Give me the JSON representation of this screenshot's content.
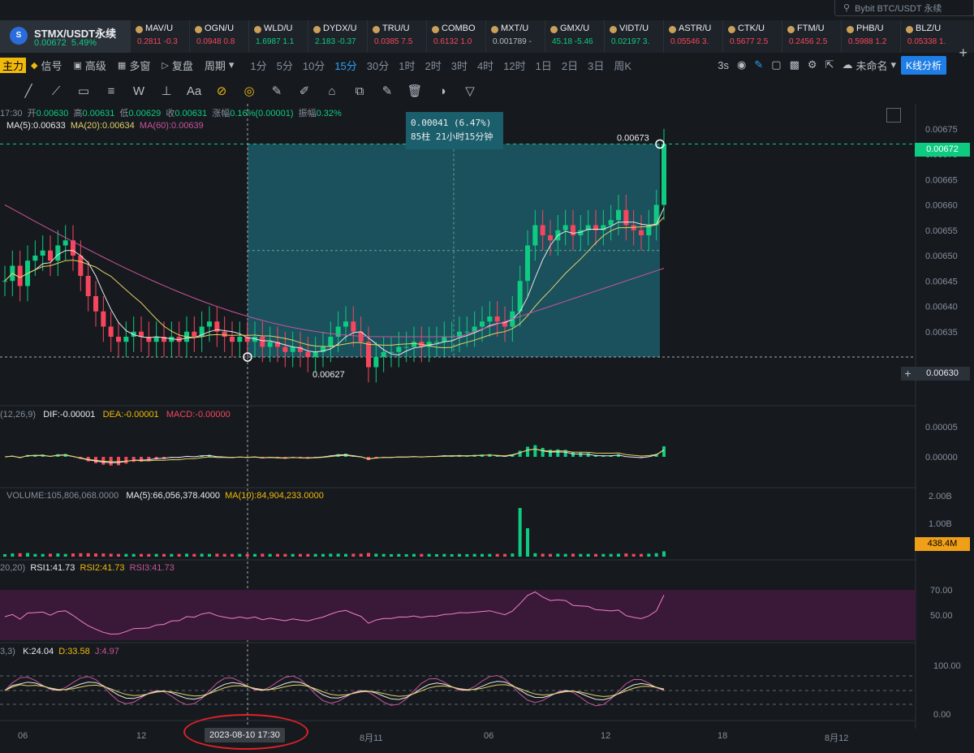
{
  "search": {
    "placeholder": "Bybit BTC/USDT 永续"
  },
  "ticker_main": {
    "coin_icon": "STMX-coin-icon",
    "name": "STMX/USDT永续",
    "price": "0.00672",
    "change": "5.49%"
  },
  "tickers": [
    {
      "name": "MAV/U",
      "price": "0.2811",
      "change": "-0.3",
      "dir": "dn"
    },
    {
      "name": "OGN/U",
      "price": "0.0948",
      "change": "0.8",
      "dir": "dn"
    },
    {
      "name": "WLD/U",
      "price": "1.6987",
      "change": "1.1",
      "dir": "up"
    },
    {
      "name": "DYDX/U",
      "price": "2.183",
      "change": "-0.37",
      "dir": "up"
    },
    {
      "name": "TRU/U",
      "price": "0.0385",
      "change": "7.5",
      "dir": "dn"
    },
    {
      "name": "COMBO",
      "price": "0.6132",
      "change": "1.0",
      "dir": "dn"
    },
    {
      "name": "MXT/U",
      "price": "0.001789",
      "change": "-",
      "dir": "neutral"
    },
    {
      "name": "GMX/U",
      "price": "45.18",
      "change": "-5.46",
      "dir": "up"
    },
    {
      "name": "VIDT/U",
      "price": "0.02197",
      "change": "3.",
      "dir": "up"
    },
    {
      "name": "ASTR/U",
      "price": "0.05546",
      "change": "3.",
      "dir": "dn"
    },
    {
      "name": "CTK/U",
      "price": "0.5677",
      "change": "2.5",
      "dir": "dn"
    },
    {
      "name": "FTM/U",
      "price": "0.2456",
      "change": "2.5",
      "dir": "dn"
    },
    {
      "name": "PHB/U",
      "price": "0.5988",
      "change": "1.2",
      "dir": "dn"
    },
    {
      "name": "BLZ/U",
      "price": "0.05338",
      "change": "1.",
      "dir": "dn"
    }
  ],
  "toolbar": {
    "left_cut": "主力",
    "items": [
      "信号",
      "高级",
      "多窗",
      "复盘",
      "周期"
    ],
    "timeframes": [
      "1分",
      "5分",
      "10分",
      "15分",
      "30分",
      "1时",
      "2时",
      "3时",
      "4时",
      "12时",
      "1日",
      "2日",
      "3日",
      "周K"
    ],
    "active_tf": "15分",
    "right_speed": "3s",
    "layout_name": "未命名",
    "analysis_btn": "K线分析"
  },
  "draw_tools": [
    "trend-line-icon",
    "ray-icon",
    "rectangle-icon",
    "parallel-channel-icon",
    "wave-icon",
    "measure-icon",
    "text-icon",
    "magnet-icon",
    "lock-icon",
    "ruler-icon",
    "pen-icon",
    "delete-icon",
    "copy-icon",
    "edit-icon",
    "trash-icon",
    "hide-icon",
    "filter-icon"
  ],
  "ohlc_line": {
    "time": "17:30",
    "open_label": "开",
    "open": "0.00630",
    "high_label": "高",
    "high": "0.00631",
    "low_label": "低",
    "low": "0.00629",
    "close_label": "收",
    "close": "0.00631",
    "chg_label": "涨幅",
    "chg": "0.16%(0.00001)",
    "amp_label": "振幅",
    "amp": "0.32%"
  },
  "ma_labels": {
    "ma5": "MA(5):0.00633",
    "ma20": "MA(20):0.00634",
    "ma60": "MA(60):0.00639"
  },
  "measure_box": {
    "line1": "0.00041 (6.47%)",
    "line2": "85柱 21小时15分钟"
  },
  "price_labels": {
    "current": "0.00672",
    "cross": "0.00630",
    "volume": "438.4M",
    "high_mark": "0.00673",
    "low_mark": "0.00627"
  },
  "macd_labels": {
    "params": "(12,26,9)",
    "dif": "DIF:-0.00001",
    "dea": "DEA:-0.00001",
    "macd": "MACD:-0.00000"
  },
  "vol_labels": {
    "volume": "VOLUME:105,806,068.0000",
    "ma5": "MA(5):66,056,378.4000",
    "ma10": "MA(10):84,904,233.0000"
  },
  "rsi_labels": {
    "params": "20,20)",
    "rsi1": "RSI1:41.73",
    "rsi2": "RSI2:41.73",
    "rsi3": "RSI3:41.73"
  },
  "kdj_labels": {
    "params": "3,3)",
    "k": "K:24.04",
    "d": "D:33.58",
    "j": "J:4.97"
  },
  "x_axis": {
    "ticks": [
      "06",
      "12",
      "8月11",
      "06",
      "12",
      "18",
      "8月12"
    ],
    "crosshair_date": "2023-08-10 17:30"
  },
  "chart_data": {
    "type": "candlestick",
    "symbol": "STMX/USDT永续",
    "interval": "15分",
    "price_axis": {
      "ticks": [
        0.00675,
        0.0067,
        0.00665,
        0.0066,
        0.00655,
        0.0065,
        0.00645,
        0.0064,
        0.00635
      ],
      "range": [
        0.00622,
        0.00678
      ]
    },
    "close_series": [
      0.00645,
      0.00648,
      0.00644,
      0.00649,
      0.0065,
      0.00651,
      0.00649,
      0.00652,
      0.00653,
      0.0065,
      0.00646,
      0.00642,
      0.00639,
      0.00636,
      0.00634,
      0.00633,
      0.00634,
      0.00635,
      0.00634,
      0.00633,
      0.00634,
      0.00633,
      0.00634,
      0.00633,
      0.00635,
      0.00634,
      0.00636,
      0.00637,
      0.00635,
      0.00634,
      0.00633,
      0.00634,
      0.00633,
      0.00634,
      0.00632,
      0.00633,
      0.00632,
      0.00631,
      0.00632,
      0.00631,
      0.0063,
      0.00631,
      0.00632,
      0.00634,
      0.00636,
      0.00637,
      0.00635,
      0.00633,
      0.00628,
      0.0063,
      0.00631,
      0.00631,
      0.00632,
      0.00632,
      0.00633,
      0.00632,
      0.00633,
      0.00633,
      0.00634,
      0.00634,
      0.00635,
      0.00635,
      0.00636,
      0.00637,
      0.00638,
      0.00637,
      0.00636,
      0.00639,
      0.00645,
      0.00652,
      0.00656,
      0.00654,
      0.00653,
      0.00655,
      0.00656,
      0.00654,
      0.00655,
      0.00656,
      0.00655,
      0.00656,
      0.00657,
      0.00659,
      0.00656,
      0.00655,
      0.00654,
      0.00656,
      0.0066,
      0.00672
    ],
    "ma5_series_end": 0.00633,
    "ma20_series_end": 0.00634,
    "ma60_series_end": 0.00639,
    "measure": {
      "from": 0.0063,
      "to": 0.00672,
      "delta": "0.00041",
      "pct": "6.47%",
      "bars": 85
    },
    "macd_axis": [
      "0.00005",
      "0.00000"
    ],
    "volume_axis": [
      "2.00B",
      "1.00B"
    ],
    "rsi_axis": [
      "70.00",
      "50.00"
    ],
    "kdj_axis": [
      "100.00",
      "0.00"
    ]
  },
  "colors": {
    "up": "#0ecb81",
    "down": "#f6465d",
    "ma5": "#e8e8e8",
    "ma20": "#e2d06a",
    "ma60": "#c9539c",
    "measure_fill": "#1b5f6c",
    "accent": "#2f9ef4"
  }
}
